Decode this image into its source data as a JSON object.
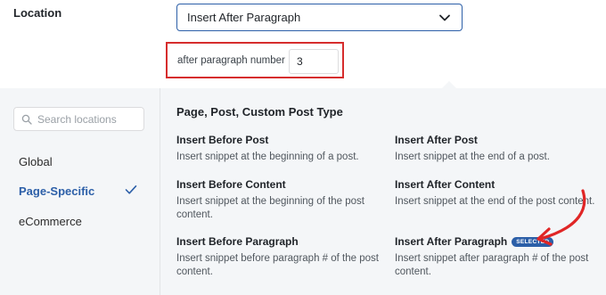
{
  "location": {
    "label": "Location",
    "select_value": "Insert After Paragraph",
    "paragraph_label": "after paragraph number",
    "paragraph_value": "3"
  },
  "sidebar": {
    "search_placeholder": "Search locations",
    "items": [
      {
        "label": "Global",
        "active": false
      },
      {
        "label": "Page-Specific",
        "active": true
      },
      {
        "label": "eCommerce",
        "active": false
      }
    ]
  },
  "main": {
    "section_title": "Page, Post, Custom Post Type",
    "options": [
      {
        "title": "Insert Before Post",
        "desc": "Insert snippet at the beginning of a post."
      },
      {
        "title": "Insert After Post",
        "desc": "Insert snippet at the end of a post."
      },
      {
        "title": "Insert Before Content",
        "desc": "Insert snippet at the beginning of the post content."
      },
      {
        "title": "Insert After Content",
        "desc": "Insert snippet at the end of the post content."
      },
      {
        "title": "Insert Before Paragraph",
        "desc": "Insert snippet before paragraph # of the post content."
      },
      {
        "title": "Insert After Paragraph",
        "desc": "Insert snippet after paragraph # of the post content.",
        "badge": "SELECTED"
      }
    ]
  },
  "colors": {
    "accent": "#2c5fa8",
    "highlight": "#d62d2d"
  },
  "icons": [
    "chevron-down-icon",
    "search-icon",
    "checkmark-icon",
    "red-arrow-annotation"
  ]
}
